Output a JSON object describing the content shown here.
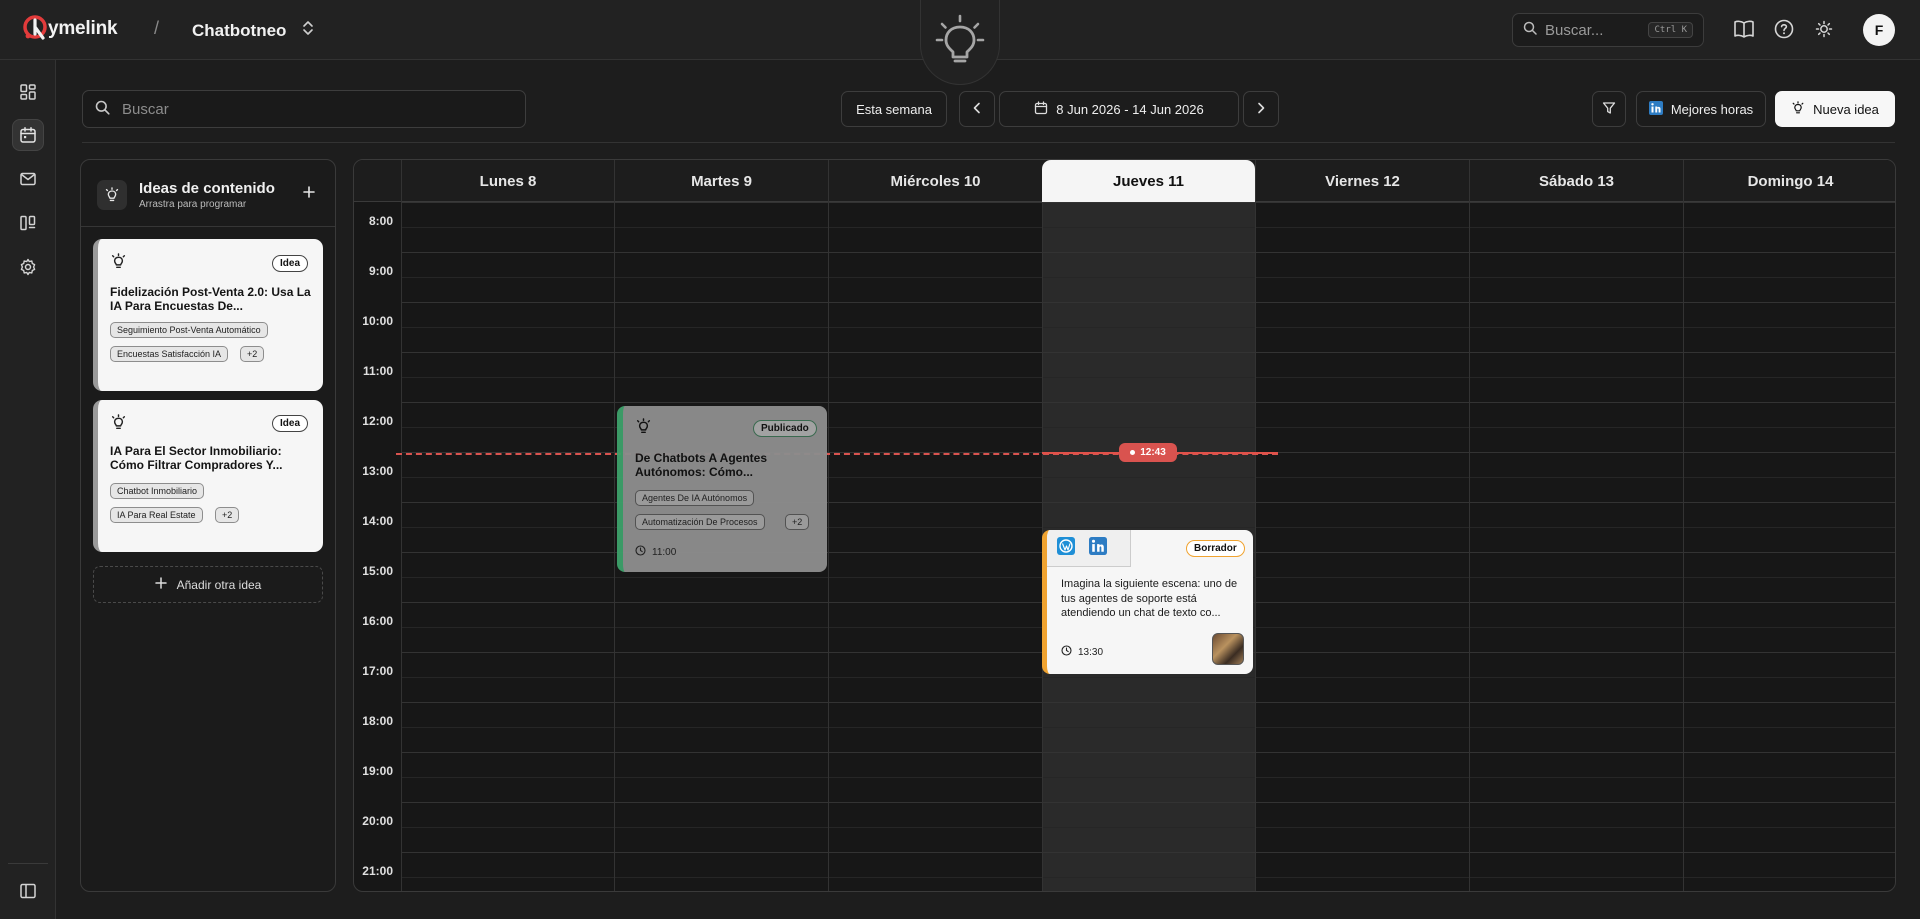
{
  "app": {
    "logo_text": "ymelink",
    "separator": "/",
    "project_name": "Chatbotneo",
    "user_initial": "F"
  },
  "top_search": {
    "placeholder": "Buscar...",
    "shortcut": "Ctrl K"
  },
  "toolbar": {
    "search_placeholder": "Buscar",
    "this_week": "Esta semana",
    "date_range": "8 Jun 2026 - 14 Jun 2026",
    "best_hours": "Mejores horas",
    "new_idea": "Nueva idea"
  },
  "ideas_panel": {
    "title": "Ideas de contenido",
    "subtitle": "Arrastra para programar",
    "add_label": "Añadir otra idea",
    "cards": [
      {
        "badge": "Idea",
        "title": "Fidelización Post-Venta 2.0: Usa La IA Para Encuestas De...",
        "tags": [
          "Seguimiento Post-Venta Automático",
          "Encuestas Satisfacción IA"
        ],
        "more": "+2"
      },
      {
        "badge": "Idea",
        "title": "IA Para El Sector Inmobiliario: Cómo Filtrar Compradores Y...",
        "tags": [
          "Chatbot Inmobiliario",
          "IA Para Real Estate"
        ],
        "more": "+2"
      }
    ]
  },
  "calendar": {
    "days": [
      "Lunes 8",
      "Martes 9",
      "Miércoles 10",
      "Jueves 11",
      "Viernes 12",
      "Sábado 13",
      "Domingo 14"
    ],
    "today_index": 3,
    "hours": [
      "8:00",
      "9:00",
      "10:00",
      "11:00",
      "12:00",
      "13:00",
      "14:00",
      "15:00",
      "16:00",
      "17:00",
      "18:00",
      "19:00",
      "20:00",
      "21:00"
    ],
    "now_time": "12:43",
    "events": {
      "published": {
        "badge": "Publicado",
        "title": "De Chatbots A Agentes Autónomos: Cómo...",
        "tags": [
          "Agentes De IA Autónomos",
          "Automatización De Procesos"
        ],
        "more": "+2",
        "time": "11:00",
        "accent": "#3da06a"
      },
      "draft": {
        "badge": "Borrador",
        "text": "Imagina la siguiente escena: uno de tus agentes de soporte está atendiendo un chat de texto co...",
        "time": "13:30",
        "accent": "#f0a330"
      }
    }
  },
  "colors": {
    "accent_now": "#d9534f",
    "background": "#1d1d1d",
    "panel": "#222222"
  }
}
